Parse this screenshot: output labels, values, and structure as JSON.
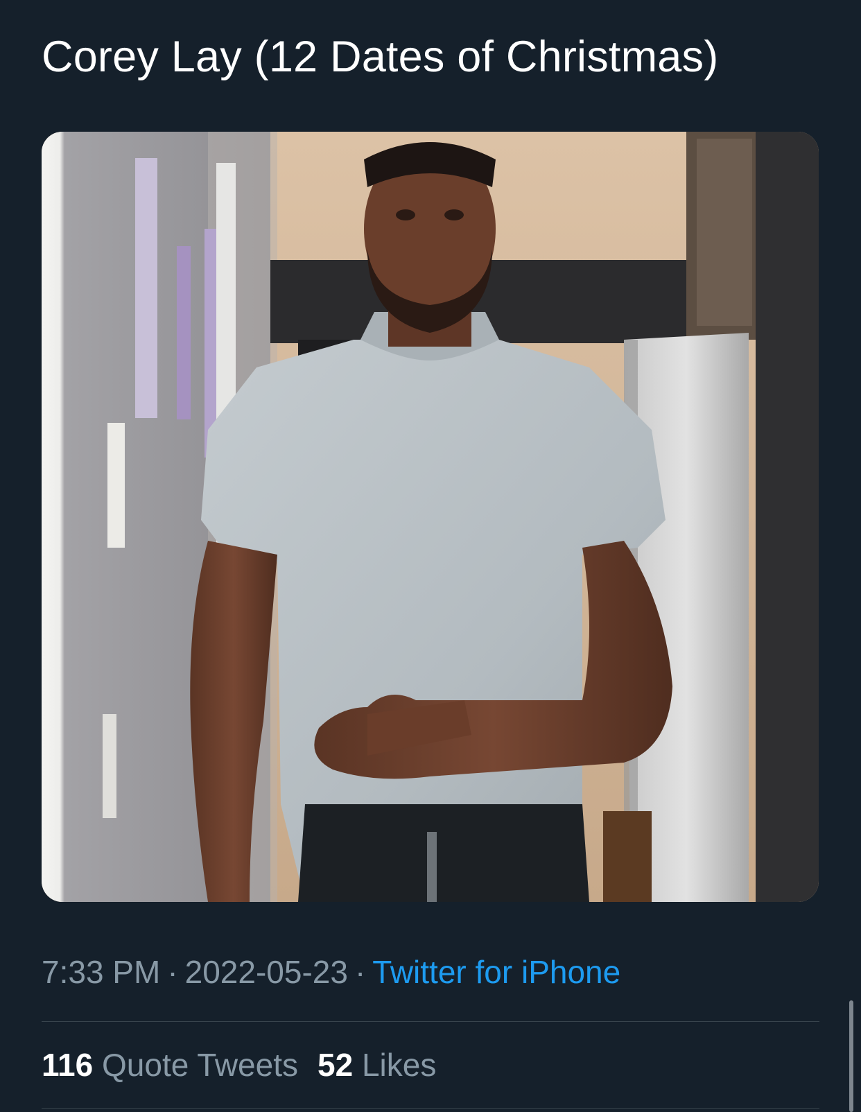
{
  "tweet": {
    "text": "Corey Lay (12 Dates of Christmas)",
    "image_alt": "Man in a light grey t-shirt standing in a hallway with one hand on his stomach"
  },
  "meta": {
    "time": "7:33 PM",
    "separator": "·",
    "date": "2022-05-23",
    "source": "Twitter for iPhone"
  },
  "stats": {
    "quote_tweets_count": "116",
    "quote_tweets_label": "Quote Tweets",
    "likes_count": "52",
    "likes_label": "Likes"
  },
  "colors": {
    "background": "#15202b",
    "primary_text": "#ffffff",
    "secondary_text": "#8899a6",
    "link": "#1d9bf0",
    "divider": "#38444d"
  }
}
